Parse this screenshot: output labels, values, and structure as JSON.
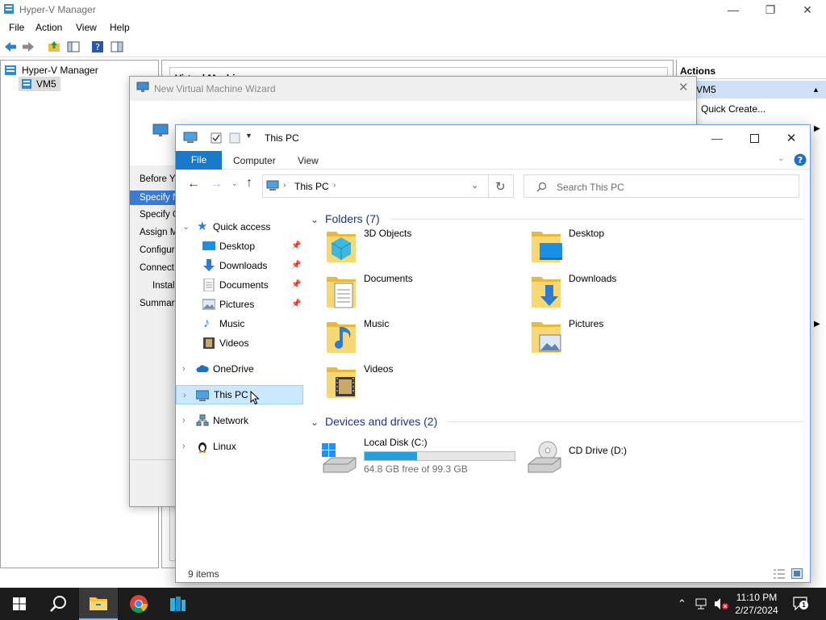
{
  "hyperv": {
    "title": "Hyper-V Manager",
    "menu": [
      "File",
      "Action",
      "View",
      "Help"
    ],
    "tree": {
      "root": "Hyper-V Manager",
      "child": "VM5"
    },
    "center_header": "Virtual Machines",
    "actions": {
      "header": "Actions",
      "group": "VM5",
      "quick_create": "Quick Create..."
    }
  },
  "wizard": {
    "title": "New Virtual Machine Wizard",
    "steps": [
      "Before You Begin",
      "Specify Name and Location",
      "Specify Generation",
      "Assign Memory",
      "Configure Networking",
      "Connect Virtual Hard Disk",
      "Installation Options",
      "Summary"
    ],
    "active_step": 1
  },
  "explorer": {
    "title": "This PC",
    "ribbon": {
      "file": "File",
      "tabs": [
        "Computer",
        "View"
      ]
    },
    "address": {
      "segment": "This PC"
    },
    "search_placeholder": "Search This PC",
    "nav": {
      "quick_access": "Quick access",
      "quick_items": [
        "Desktop",
        "Downloads",
        "Documents",
        "Pictures",
        "Music",
        "Videos"
      ],
      "onedrive": "OneDrive",
      "this_pc": "This PC",
      "network": "Network",
      "linux": "Linux"
    },
    "folders_header": "Folders (7)",
    "folders": [
      "3D Objects",
      "Desktop",
      "Documents",
      "Downloads",
      "Music",
      "Pictures",
      "Videos"
    ],
    "drives_header": "Devices and drives (2)",
    "drives": [
      {
        "name": "Local Disk (C:)",
        "free": "64.8 GB free of 99.3 GB",
        "used_fraction": 0.347
      },
      {
        "name": "CD Drive (D:)"
      }
    ],
    "status": "9 items"
  },
  "taskbar": {
    "time": "11:10 PM",
    "date": "2/27/2024",
    "notifications": "1"
  },
  "colors": {
    "accent": "#1979ca",
    "selection": "#cce8ff",
    "folder": "#f8d775",
    "drive_bar": "#26a0da",
    "wizard_active": "#3a7bd5"
  }
}
